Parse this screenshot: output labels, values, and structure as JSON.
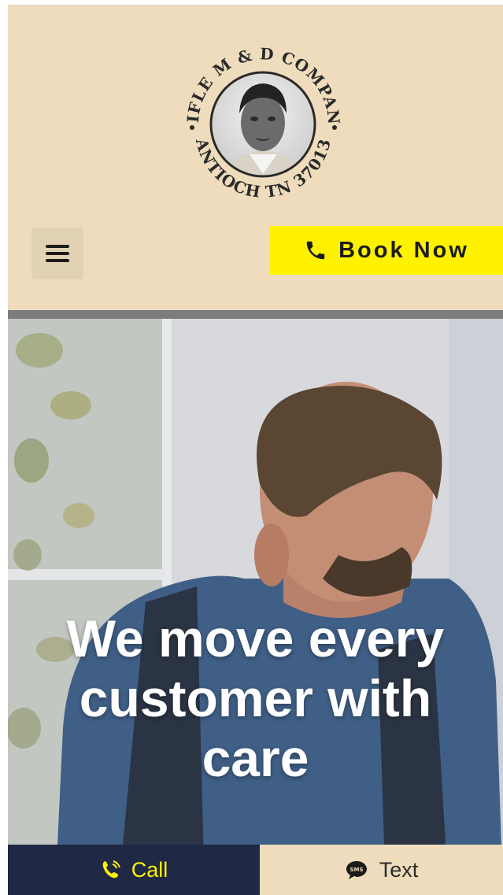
{
  "header": {
    "logo": {
      "top_text": "KIFLE M & D COMPANY",
      "bottom_text": "ANTIOCH TN 37013"
    },
    "menu_icon": "hamburger-menu-icon",
    "book_button": {
      "icon": "phone-icon",
      "label": "Book Now"
    }
  },
  "hero": {
    "title": "We move every customer with care"
  },
  "bottom_bar": {
    "call": {
      "icon": "phone-ringing-icon",
      "label": "Call"
    },
    "text": {
      "icon": "sms-chat-icon",
      "label": "Text"
    }
  },
  "colors": {
    "header_bg": "#eedcbd",
    "accent_yellow": "#fff200",
    "navy": "#1f2845"
  }
}
